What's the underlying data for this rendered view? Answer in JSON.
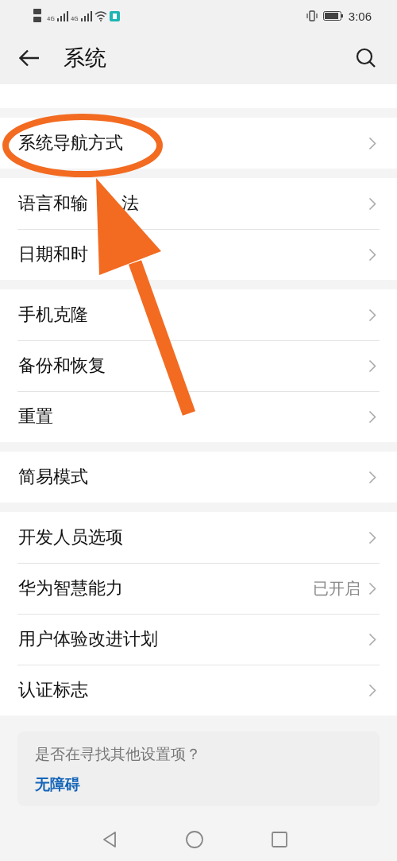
{
  "status_bar": {
    "time": "3:06",
    "network_1": "4G",
    "network_2": "4G"
  },
  "header": {
    "title": "系统"
  },
  "groups": [
    {
      "items": [
        {
          "label": "系统导航方式",
          "highlighted": true
        }
      ]
    },
    {
      "items": [
        {
          "label": "语言和输",
          "label_tail": "法"
        },
        {
          "label": "日期和时"
        }
      ]
    },
    {
      "items": [
        {
          "label": "手机克隆"
        },
        {
          "label": "备份和恢复"
        },
        {
          "label": "重置"
        }
      ]
    },
    {
      "items": [
        {
          "label": "简易模式"
        }
      ]
    },
    {
      "items": [
        {
          "label": "开发人员选项"
        },
        {
          "label": "华为智慧能力",
          "value": "已开启"
        },
        {
          "label": "用户体验改进计划"
        },
        {
          "label": "认证标志"
        }
      ]
    }
  ],
  "suggestion": {
    "question": "是否在寻找其他设置项？",
    "link": "无障碍"
  }
}
